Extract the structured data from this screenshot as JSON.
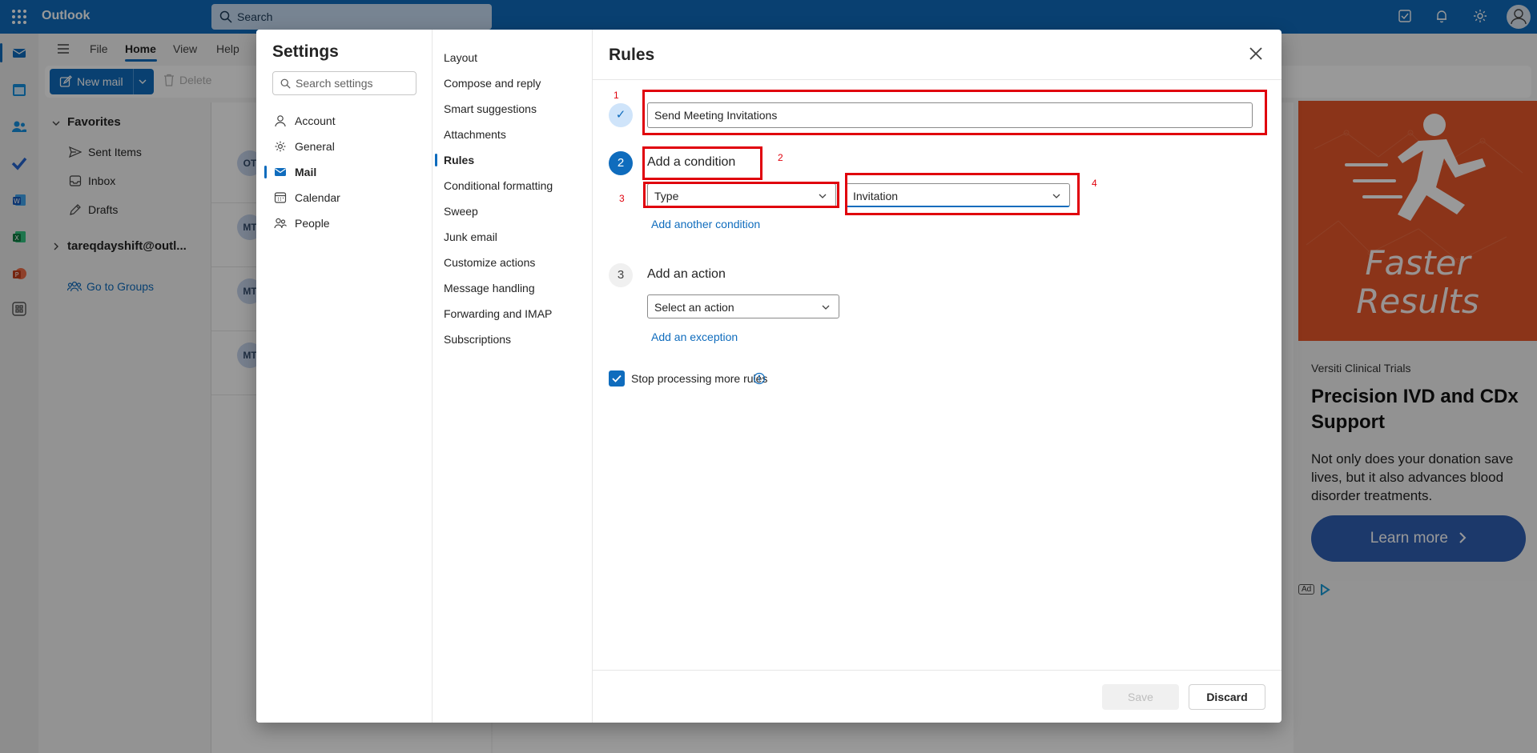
{
  "app": {
    "brand": "Outlook",
    "search_placeholder": "Search"
  },
  "ribbon": {
    "tabs": [
      "File",
      "Home",
      "View",
      "Help"
    ],
    "active_tab": "Home",
    "new_mail": "New mail",
    "delete": "Delete"
  },
  "folders": {
    "favorites": "Favorites",
    "items": [
      "Sent Items",
      "Inbox",
      "Drafts"
    ],
    "account": "tareqdayshift@outl...",
    "groups": "Go to Groups"
  },
  "messages": {
    "avatars": [
      "OT",
      "MT",
      "MT",
      "MT"
    ]
  },
  "ad": {
    "hero_line1": "Faster",
    "hero_line2": "Results",
    "source": "Versiti Clinical Trials",
    "headline": "Precision IVD and CDx Support",
    "body": "Not only does your donation save lives, but it also advances blood disorder treatments.",
    "cta": "Learn more",
    "tag": "Ad"
  },
  "settings": {
    "title": "Settings",
    "search_placeholder": "Search settings",
    "nav": [
      "Account",
      "General",
      "Mail",
      "Calendar",
      "People"
    ],
    "active_nav": "Mail",
    "mail_nav": [
      "Layout",
      "Compose and reply",
      "Smart suggestions",
      "Attachments",
      "Rules",
      "Conditional formatting",
      "Sweep",
      "Junk email",
      "Customize actions",
      "Message handling",
      "Forwarding and IMAP",
      "Subscriptions"
    ],
    "active_mail_nav": "Rules"
  },
  "rules": {
    "title": "Rules",
    "step1_check": "✓",
    "step2_num": "2",
    "step3_num": "3",
    "rule_name": "Send Meeting Invitations",
    "add_condition": "Add a condition",
    "condition_type": "Type",
    "condition_value": "Invitation",
    "add_another_condition": "Add another condition",
    "add_action": "Add an action",
    "action_placeholder": "Select an action",
    "add_exception": "Add an exception",
    "stop_processing": "Stop processing more rules",
    "save": "Save",
    "discard": "Discard"
  },
  "annotations": [
    "1",
    "2",
    "3",
    "4"
  ],
  "colors": {
    "accent": "#0f6cbd",
    "annotation": "#e0000c",
    "ad_hero": "#e8572a",
    "ad_cta": "#2f5fb3"
  }
}
